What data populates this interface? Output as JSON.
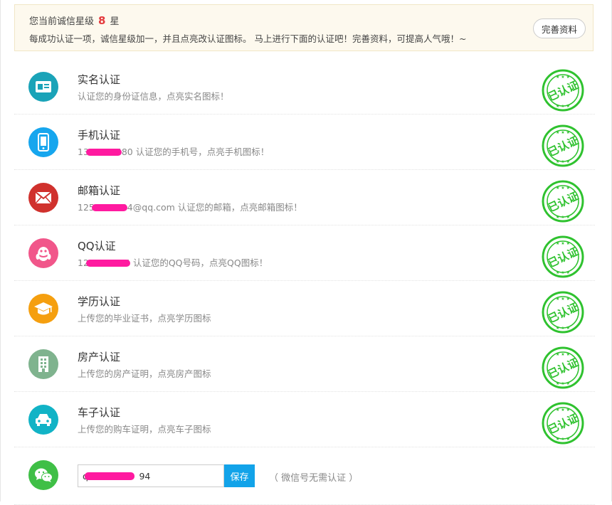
{
  "notice": {
    "prefix": "您当前诚信星级",
    "star_value": "8",
    "suffix": "星",
    "message": "每成功认证一项，诚信星级加一，并且点亮改认证图标。 马上进行下面的认证吧！完善资料，可提高人气哦！~",
    "button": "完善资料"
  },
  "stamp_text": "已认证",
  "items": [
    {
      "title": "实名认证",
      "desc_pre": "",
      "desc": "认证您的身份证信息，点亮实名图标！",
      "icon": "id-card-icon",
      "color": "#1aa3b8"
    },
    {
      "title": "手机认证",
      "desc_pre": "13",
      "desc": "580 认证您的手机号，点亮手机图标！",
      "icon": "mobile-phone-icon",
      "color": "#16a6ee"
    },
    {
      "title": "邮箱认证",
      "desc_pre": "125",
      "desc": "94@qq.com 认证您的邮箱，点亮邮箱图标！",
      "icon": "envelope-icon",
      "color": "#d0312d"
    },
    {
      "title": "QQ认证",
      "desc_pre": "12",
      "desc": "4 认证您的QQ号码，点亮QQ图标！",
      "icon": "qq-penguin-icon",
      "color": "#f1568a"
    },
    {
      "title": "学历认证",
      "desc_pre": "",
      "desc": "上传您的毕业证书，点亮学历图标",
      "icon": "graduation-cap-icon",
      "color": "#f59f0f"
    },
    {
      "title": "房产认证",
      "desc_pre": "",
      "desc": "上传您的房产证明，点亮房产图标",
      "icon": "building-icon",
      "color": "#7fb38e"
    },
    {
      "title": "车子认证",
      "desc_pre": "",
      "desc": "上传您的购车证明，点亮车子图标",
      "icon": "car-icon",
      "color": "#11b3c6"
    }
  ],
  "wechat": {
    "icon": "wechat-icon",
    "color": "#3fbf46",
    "input_value": "q                  94",
    "save_label": "保存",
    "note": "（ 微信号无需认证 ）"
  }
}
